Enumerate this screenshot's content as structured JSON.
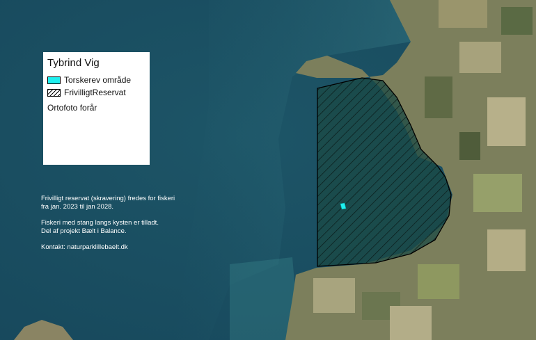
{
  "legend": {
    "title": "Tybrind Vig",
    "items": [
      {
        "label": "Torskerev område",
        "symbol": "cyan-fill",
        "color": "#1ff0f0"
      },
      {
        "label": "FrivilligtReservat",
        "symbol": "hatched-fill",
        "color": "#000000"
      }
    ],
    "basemap_label": "Ortofoto forår"
  },
  "info": {
    "line1": "Frivilligt reservat (skravering) fredes for fiskeri",
    "line2": "fra jan. 2023 til jan 2028.",
    "line3": "Fiskeri med stang langs kysten er tilladt.",
    "line4": "Del af projekt Bælt i Balance.",
    "line5": "Kontakt: naturparklillebaelt.dk"
  },
  "colors": {
    "sea": "#1d4f63",
    "land": "#7a7d5a",
    "reserve_fill": "#1b4a44",
    "reef": "#1ff0f0"
  }
}
